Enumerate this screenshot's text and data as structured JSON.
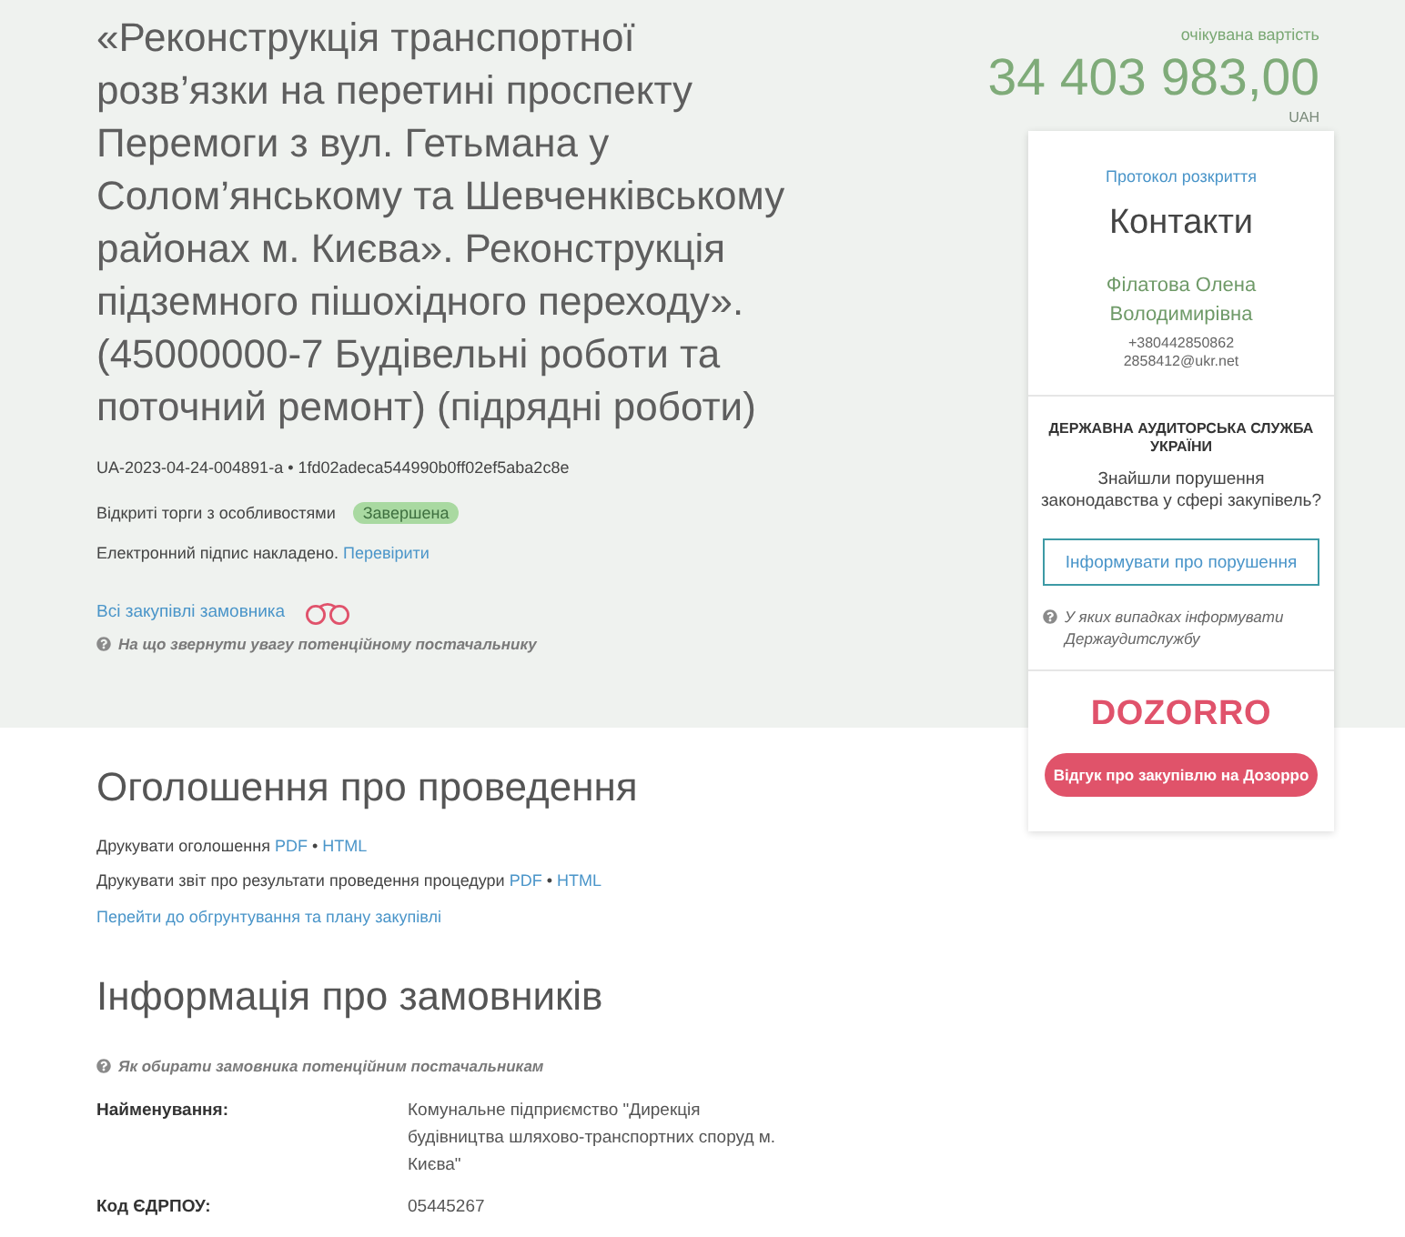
{
  "tender": {
    "title": "«Реконструкція транспортної розв’язки на перетині проспекту Перемоги з вул. Гетьмана у Солом’янському та Шевченківському районах м. Києва». Реконструкція підземного пішохідного переходу». (45000000-7 Будівельні роботи та поточний ремонт) (підрядні роботи)",
    "code": "UA-2023-04-24-004891-a • 1fd02adeca544990b0ff02ef5aba2c8e",
    "procedure": "Відкриті торги з особливостями",
    "status": "Завершена",
    "signature": {
      "text": "Електронний підпис накладено.",
      "link": "Перевірити"
    },
    "customer_link": "Всі закупівлі замовника",
    "hint": "На що звернути увагу потенційному постачальнику"
  },
  "price": {
    "caption": "очікувана вартість",
    "amount": "34 403 983,00",
    "currency": "UAH"
  },
  "sidebar": {
    "protocol_link": "Протокол розкриття",
    "contacts_title": "Контакти",
    "contact_name": "Філатова Олена Володимирівна",
    "phone": "+380442850862",
    "email": "2858412@ukr.net",
    "audit": {
      "title": "ДЕРЖАВНА АУДИТОРСЬКА СЛУЖБА УКРАЇНИ",
      "question": "Знайшли порушення законодавства у сфері закупівель?",
      "button": "Інформувати про порушення",
      "hint": "У яких випадках інформувати Держаудитслужбу"
    },
    "dozorro": {
      "logo": "DOZORRO",
      "button": "Відгук про закупівлю на Дозорро"
    }
  },
  "announcement": {
    "heading": "Оголошення про проведення",
    "separator": "•",
    "lines": [
      {
        "text": "Друкувати оголошення",
        "links": [
          "PDF",
          "HTML"
        ]
      },
      {
        "text": "Друкувати звіт про результати проведення процедури",
        "links": [
          "PDF",
          "HTML"
        ]
      }
    ],
    "plan_link": "Перейти до обгрунтування та плану закупівлі"
  },
  "customer_info": {
    "heading": "Інформація про замовників",
    "hint": "Як обирати замовника потенційним постачальникам",
    "fields": [
      {
        "label": "Найменування:",
        "value": "Комунальне підприємство \"Дирекція будівництва шляхово-транспортних споруд м. Києва\""
      },
      {
        "label": "Код ЄДРПОУ:",
        "value": "05445267"
      }
    ]
  }
}
